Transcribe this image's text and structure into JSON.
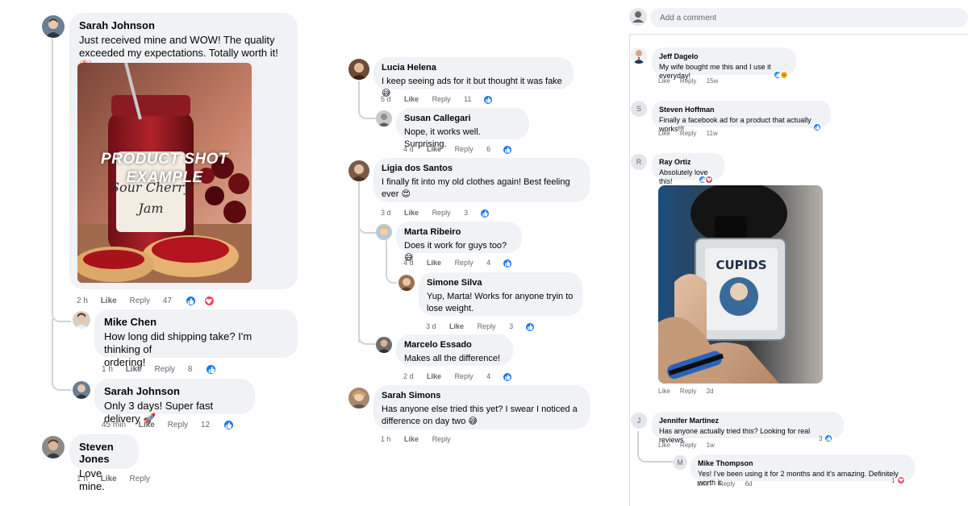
{
  "colors": {
    "bubble": "#f0f2f5",
    "meta_text": "#65676b",
    "like_blue": "#1877f2",
    "love_red": "#f33e58",
    "haha_yellow": "#f7b125"
  },
  "col1": {
    "c1": {
      "author": "Sarah Johnson",
      "text1": "Just received mine and WOW! The quality",
      "text2": "exceeded my expectations. Totally worth it! 🎉",
      "time": "2 h",
      "like": "Like",
      "reply": "Reply",
      "count": "47",
      "image_text1": "PRODUCT SHOT",
      "image_text2": "EXAMPLE",
      "jar_label1": "Sour Cherry",
      "jar_label2": "Jam"
    },
    "c2": {
      "author": "Mike Chen",
      "text1": "How long did shipping take? I'm thinking of",
      "text2": "ordering!",
      "time": "1 h",
      "like": "Like",
      "reply": "Reply",
      "count": "8"
    },
    "c3": {
      "author": "Sarah Johnson",
      "text1": "Only 3 days! Super fast delivery 🚀",
      "time": "45 min",
      "like": "Like",
      "reply": "Reply",
      "count": "12"
    },
    "c4": {
      "author": "Steven Jones",
      "text1": "Love mine.",
      "time": "1 h",
      "like": "Like",
      "reply": "Reply"
    }
  },
  "col2": {
    "c1": {
      "author": "Lucia Helena",
      "text1": "I keep seeing ads for it but thought it was fake 😅",
      "time": "5 d",
      "like": "Like",
      "reply": "Reply",
      "count": "11"
    },
    "c2": {
      "author": "Susan Callegari",
      "text1": "Nope, it works well. Surprising.",
      "time": "4 d",
      "like": "Like",
      "reply": "Reply",
      "count": "6"
    },
    "c3": {
      "author": "Ligia dos Santos",
      "text1": "I finally fit into my old clothes again! Best feeling",
      "text2": "ever 😍",
      "time": "3 d",
      "like": "Like",
      "reply": "Reply",
      "count": "3"
    },
    "c4": {
      "author": "Marta Ribeiro",
      "text1": "Does it work for guys too? 😅",
      "time": "4 d",
      "like": "Like",
      "reply": "Reply",
      "count": "4"
    },
    "c5": {
      "author": "Simone Silva",
      "text1": "Yup, Marta! Works for anyone tryin to",
      "text2": "lose weight.",
      "time": "3 d",
      "like": "Like",
      "reply": "Reply",
      "count": "3"
    },
    "c6": {
      "author": "Marcelo Essado",
      "text1": "Makes all the difference!",
      "time": "2 d",
      "like": "Like",
      "reply": "Reply",
      "count": "4"
    },
    "c7": {
      "author": "Sarah Simons",
      "text1": "Has anyone else tried this yet? I swear I noticed a",
      "text2": "difference on day two 😅",
      "time": "1 h",
      "like": "Like",
      "reply": "Reply"
    }
  },
  "col3": {
    "add_comment_placeholder": "Add a comment",
    "c1": {
      "author": "Jeff Dagelo",
      "text1": "My wife bought me this and I use it everyday!",
      "like": "Like",
      "reply": "Reply",
      "time": "15w"
    },
    "c2": {
      "avatar_letter": "S",
      "author": "Steven Hoffman",
      "text1": "Finally a facebook ad for a product that actually works!!!",
      "like": "Like",
      "reply": "Reply",
      "time": "11w"
    },
    "c3": {
      "avatar_letter": "R",
      "author": "Ray Ortiz",
      "text1": "Absolutely love this!",
      "like": "Like",
      "reply": "Reply",
      "time": "2d",
      "product_label": "CUPIDS"
    },
    "c4": {
      "avatar_letter": "J",
      "author": "Jennifer Martinez",
      "text1": "Has anyone actually tried this? Looking for real reviews.",
      "like": "Like",
      "reply": "Reply",
      "time": "1w",
      "count": "3"
    },
    "c5": {
      "avatar_letter": "M",
      "author": "Mike Thompson",
      "text1": "Yes! I've been using it for 2 months and it's amazing. Definitely worth it.",
      "like": "Like",
      "reply": "Reply",
      "time": "6d",
      "count": "1"
    }
  }
}
